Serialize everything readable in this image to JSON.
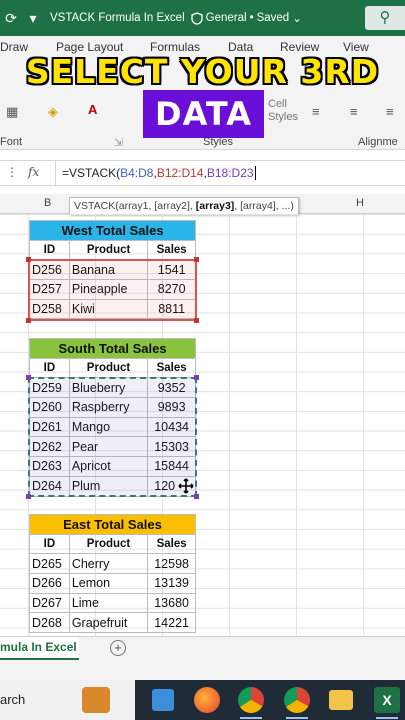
{
  "titlebar": {
    "document_title": "VSTACK Formula In Excel",
    "sensitivity": "General",
    "save_status": "Saved",
    "colors": {
      "bar": "#1e7145"
    }
  },
  "ribbon": {
    "tabs": [
      "Draw",
      "Page Layout",
      "Formulas",
      "Data",
      "Review",
      "View"
    ],
    "groups": {
      "font": "Font",
      "styles": "Styles",
      "alignment": "Alignme",
      "cell_styles": "Cell Styles"
    }
  },
  "caption": {
    "line1": "SELECT YOUR 3RD",
    "line2": "DATA",
    "colors": {
      "text": "#ffe400",
      "box": "#6a0fd8"
    }
  },
  "formula_bar": {
    "fx": "fx",
    "prefix": "=VSTACK(",
    "arg1": "B4:D8",
    "arg2": "B12:D14",
    "arg3": "B18:D23",
    "sep": ","
  },
  "tooltip": {
    "pre": "VSTACK(array1, [array2], ",
    "bold": "[array3]",
    "post": ", [array4], ...)"
  },
  "columns": {
    "b": "B",
    "h": "H"
  },
  "west": {
    "title": "West Total Sales",
    "headers": [
      "ID",
      "Product",
      "Sales"
    ],
    "rows": [
      [
        "D256",
        "Banana",
        "1541"
      ],
      [
        "D257",
        "Pineapple",
        "8270"
      ],
      [
        "D258",
        "Kiwi",
        "8811"
      ]
    ],
    "color": "#29b5e8"
  },
  "south": {
    "title": "South Total Sales",
    "headers": [
      "ID",
      "Product",
      "Sales"
    ],
    "rows": [
      [
        "D259",
        "Blueberry",
        "9352"
      ],
      [
        "D260",
        "Raspberry",
        "9893"
      ],
      [
        "D261",
        "Mango",
        "10434"
      ],
      [
        "D262",
        "Pear",
        "15303"
      ],
      [
        "D263",
        "Apricot",
        "15844"
      ],
      [
        "D264",
        "Plum",
        "120"
      ]
    ],
    "color": "#8ac43f"
  },
  "east": {
    "title": "East Total Sales",
    "headers": [
      "ID",
      "Product",
      "Sales"
    ],
    "rows": [
      [
        "D265",
        "Cherry",
        "12598"
      ],
      [
        "D266",
        "Lemon",
        "13139"
      ],
      [
        "D267",
        "Lime",
        "13680"
      ],
      [
        "D268",
        "Grapefruit",
        "14221"
      ]
    ],
    "color": "#fbbf00"
  },
  "sheet": {
    "active_tab": "mula In Excel"
  },
  "taskbar": {
    "search_label": "arch"
  }
}
